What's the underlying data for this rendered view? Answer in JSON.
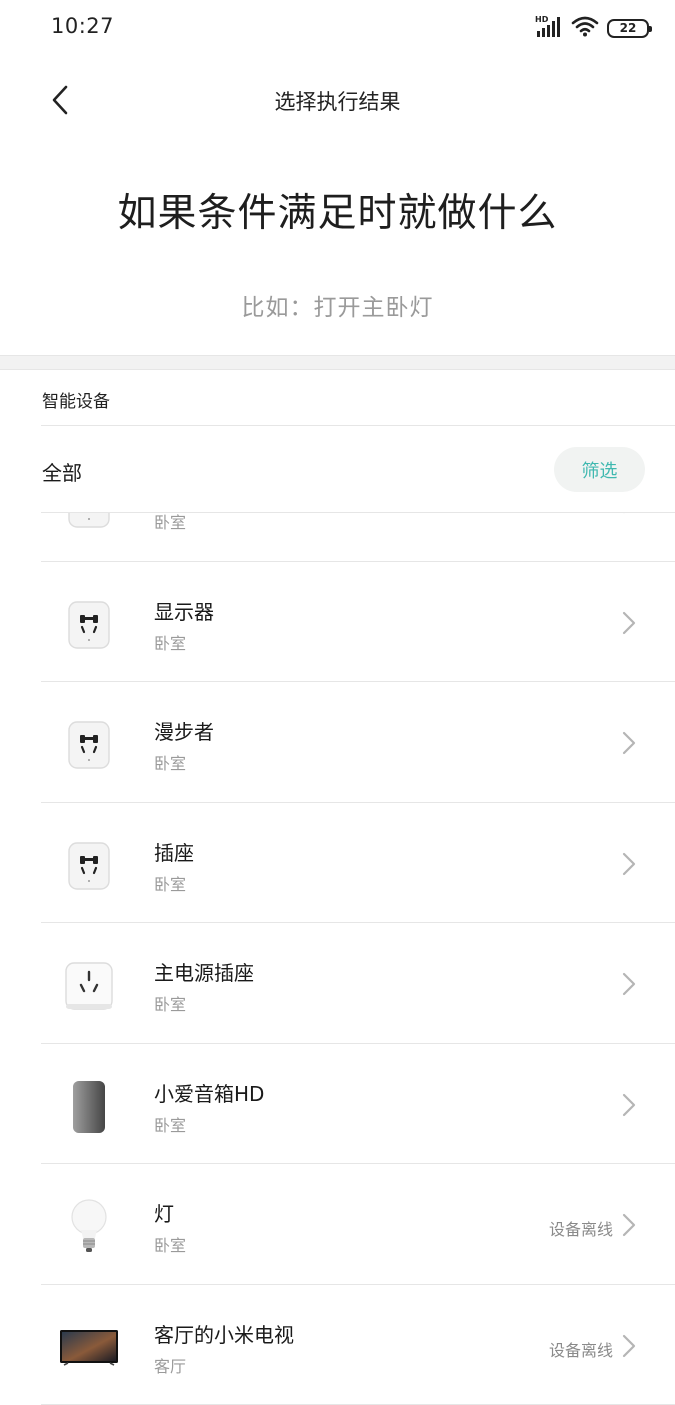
{
  "status_bar": {
    "time": "10:27",
    "network": "HD",
    "battery": "22",
    "icons": [
      "hd-signal-icon",
      "wifi-icon",
      "battery-icon"
    ]
  },
  "nav": {
    "title": "选择执行结果",
    "back_icon": "back-chevron-icon"
  },
  "hero": {
    "title": "如果条件满足时就做什么",
    "subtitle": "比如：打开主卧灯"
  },
  "section": {
    "label": "智能设备"
  },
  "filter": {
    "label": "全部",
    "button": "筛选"
  },
  "devices": [
    {
      "name": "",
      "room": "卧室",
      "icon": "smart-plug-icon",
      "status": ""
    },
    {
      "name": "显示器",
      "room": "卧室",
      "icon": "smart-plug-icon",
      "status": ""
    },
    {
      "name": "漫步者",
      "room": "卧室",
      "icon": "smart-plug-icon",
      "status": ""
    },
    {
      "name": "插座",
      "room": "卧室",
      "icon": "smart-plug-icon",
      "status": ""
    },
    {
      "name": "主电源插座",
      "room": "卧室",
      "icon": "power-strip-icon",
      "status": ""
    },
    {
      "name": "小爱音箱HD",
      "room": "卧室",
      "icon": "speaker-icon",
      "status": ""
    },
    {
      "name": "灯",
      "room": "卧室",
      "icon": "light-bulb-icon",
      "status": "设备离线"
    },
    {
      "name": "客厅的小米电视",
      "room": "客厅",
      "icon": "tv-icon",
      "status": "设备离线"
    }
  ],
  "colors": {
    "accent": "#3fb8b0",
    "secondary_text": "#9a9a9a",
    "divider": "#e6e6e6"
  }
}
